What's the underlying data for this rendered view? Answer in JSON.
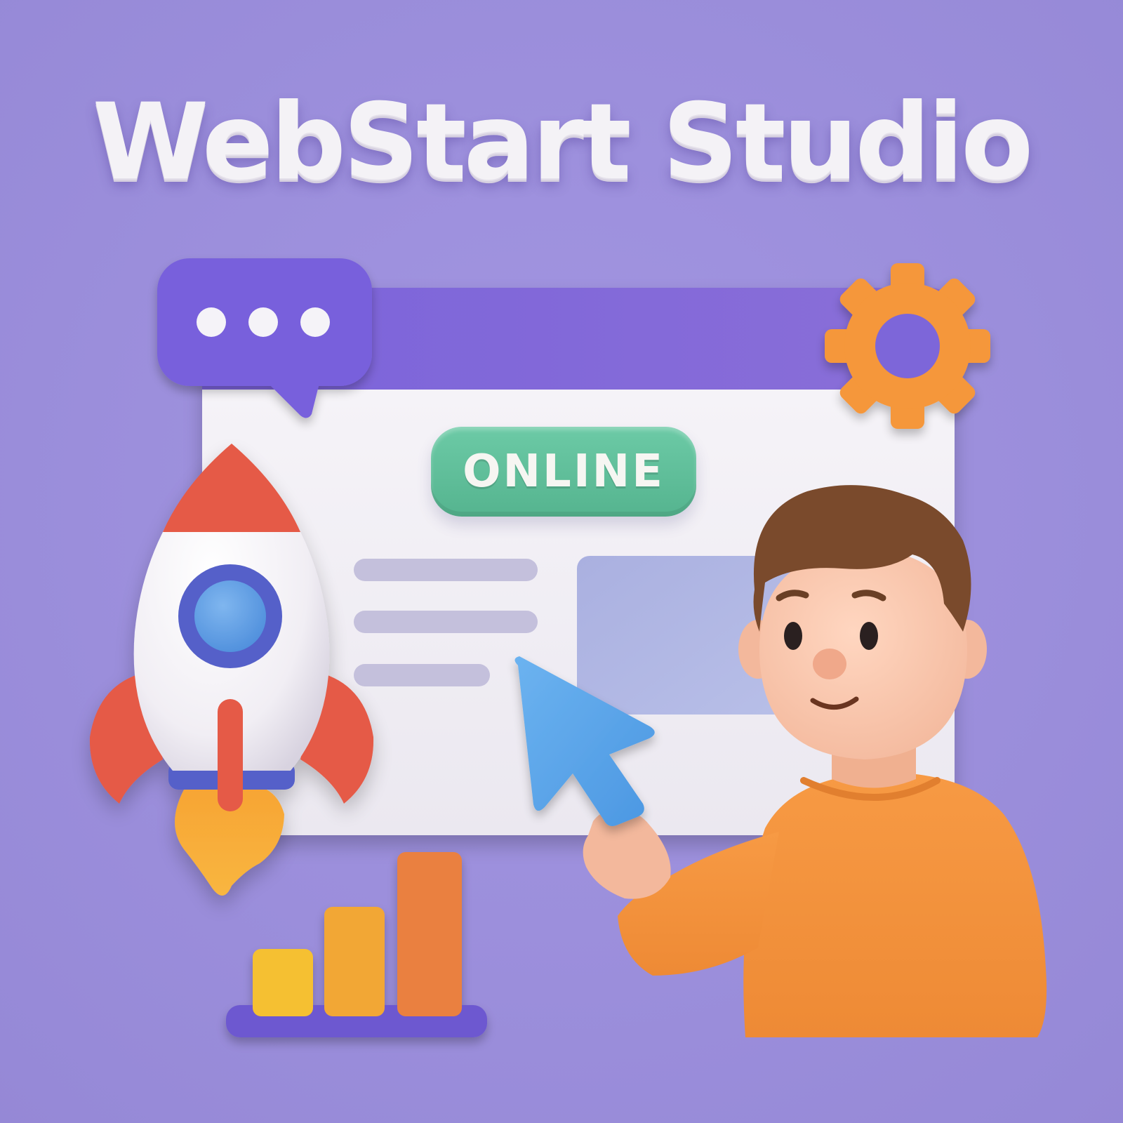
{
  "title": "WebStart Studio",
  "badge": {
    "label": "ONLINE"
  },
  "colors": {
    "background": "#9b8fdc",
    "title_text": "#f4f2f6",
    "browser_bar": "#7d66d9",
    "badge": "#5fbf9a",
    "gear": "#f5973a",
    "rocket_fins": "#e55a47",
    "cursor": "#5aa5e8",
    "sweater": "#f4913a",
    "hair": "#7a4a2c",
    "bar_small": "#f5c030",
    "bar_medium": "#f2a736",
    "bar_large": "#ea8040"
  },
  "icons": [
    "chat-bubble-icon",
    "gear-icon",
    "rocket-icon",
    "cursor-arrow-icon",
    "bar-chart-icon"
  ]
}
